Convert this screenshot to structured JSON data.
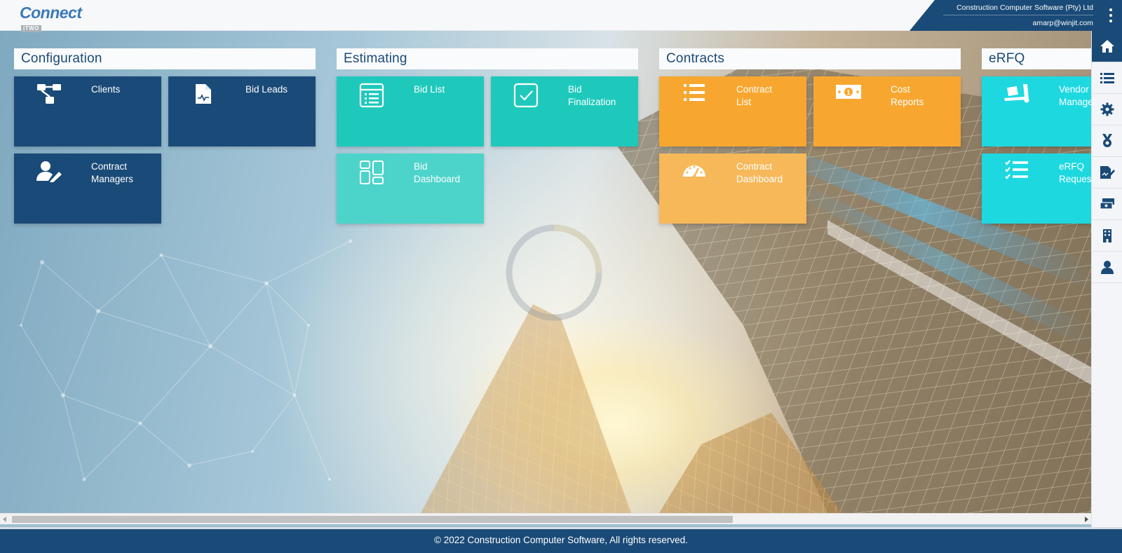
{
  "header": {
    "logo": {
      "brand": "Connect",
      "sub": "iTWO"
    },
    "company": "Construction Computer Software (Pty) Ltd",
    "email": "amarp@winjit.com",
    "menu_icon": "kebab-menu-icon"
  },
  "sections": [
    {
      "title": "Configuration",
      "tiles": [
        {
          "label": "Clients",
          "icon": "hierarchy-icon"
        },
        {
          "label": "Bid Leads",
          "icon": "document-chart-icon"
        },
        {
          "label": "Contract\nManagers",
          "icon": "user-edit-icon"
        }
      ]
    },
    {
      "title": "Estimating",
      "tiles": [
        {
          "label": "Bid List",
          "icon": "list-box-icon"
        },
        {
          "label": "Bid\nFinalization",
          "icon": "checkbox-icon"
        },
        {
          "label": "Bid\nDashboard",
          "icon": "dashboard-layout-icon"
        }
      ]
    },
    {
      "title": "Contracts",
      "tiles": [
        {
          "label": "Contract\nList",
          "icon": "bullet-list-icon"
        },
        {
          "label": "Cost\nReports",
          "icon": "money-bill-icon"
        },
        {
          "label": "Contract\nDashboard",
          "icon": "gauge-icon"
        }
      ]
    },
    {
      "title": "eRFQ",
      "tiles": [
        {
          "label": "Vendor\nManage",
          "icon": "dolly-icon"
        },
        {
          "label": "eRFQ\nReques",
          "icon": "checklist-icon"
        }
      ]
    }
  ],
  "rightnav": [
    {
      "icon": "home-icon",
      "active": true
    },
    {
      "icon": "list-icon"
    },
    {
      "icon": "gear-icon"
    },
    {
      "icon": "medal-icon"
    },
    {
      "icon": "signature-icon"
    },
    {
      "icon": "money-stack-icon"
    },
    {
      "icon": "building-icon"
    },
    {
      "icon": "user-icon"
    }
  ],
  "footer": {
    "text": "© 2022 Construction Computer Software, All rights reserved."
  },
  "colors": {
    "navy": "#1a4a77",
    "teal": "#1ec9bc",
    "teal_light": "#4dd4ca",
    "orange": "#f7a730",
    "orange_light": "#f7b85a",
    "cyan": "#1ed8e0"
  }
}
